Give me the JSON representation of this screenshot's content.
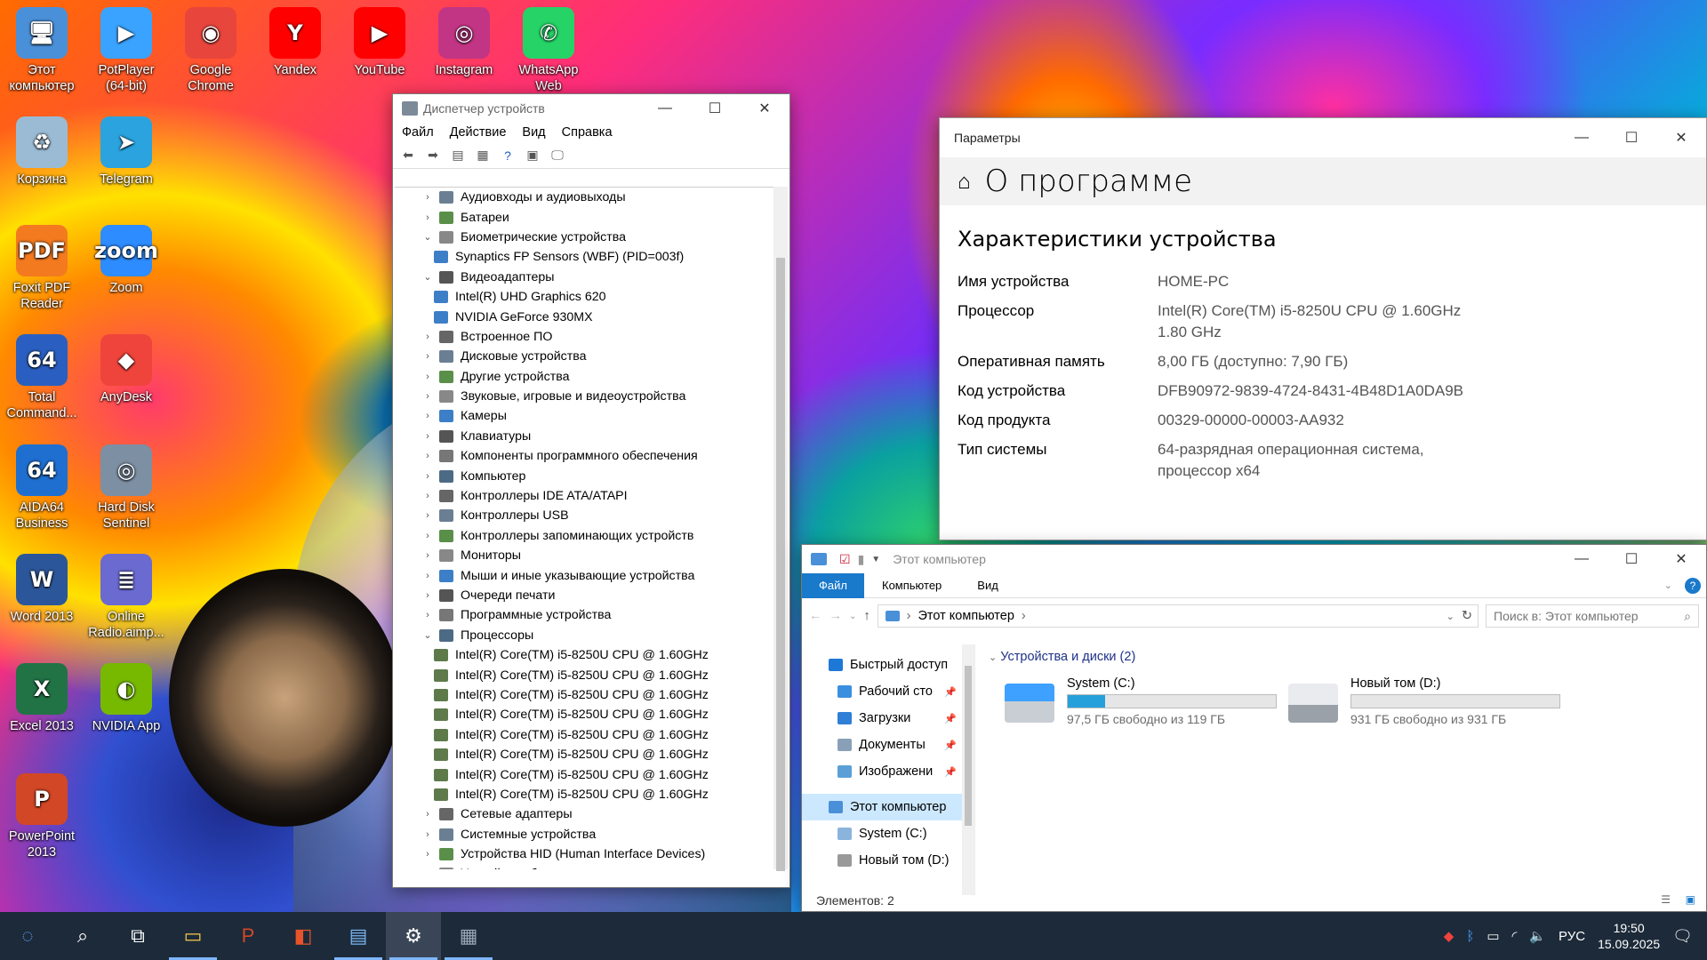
{
  "desktop": {
    "icons": [
      {
        "label": "Этот компьютер",
        "glyph": "🖥",
        "bg": "#4a90d9"
      },
      {
        "label": "PotPlayer (64-bit)",
        "glyph": "▶",
        "bg": "#3aa3ff"
      },
      {
        "label": "Google Chrome",
        "glyph": "◉",
        "bg": "#e8453c"
      },
      {
        "label": "Yandex",
        "glyph": "Y",
        "bg": "#ff0000"
      },
      {
        "label": "YouTube",
        "glyph": "▶",
        "bg": "#ff0000"
      },
      {
        "label": "Instagram",
        "glyph": "◎",
        "bg": "#c13584"
      },
      {
        "label": "WhatsApp Web",
        "glyph": "✆",
        "bg": "#25d366"
      },
      {
        "label": "Корзина",
        "glyph": "♻",
        "bg": "#9bbbd4"
      },
      {
        "label": "Telegram",
        "glyph": "➤",
        "bg": "#2aa3df"
      },
      {
        "label": "Foxit PDF Reader",
        "glyph": "PDF",
        "bg": "#f47a20"
      },
      {
        "label": "Zoom",
        "glyph": "zoom",
        "bg": "#2d8cff"
      },
      {
        "label": "Total Command...",
        "glyph": "64",
        "bg": "#2a5fc1"
      },
      {
        "label": "AnyDesk",
        "glyph": "◆",
        "bg": "#ef443b"
      },
      {
        "label": "AIDA64 Business",
        "glyph": "64",
        "bg": "#1f6fd1"
      },
      {
        "label": "Hard Disk Sentinel",
        "glyph": "◎",
        "bg": "#7d8fa3"
      },
      {
        "label": "Word 2013",
        "glyph": "W",
        "bg": "#2b579a"
      },
      {
        "label": "Online Radio.aimp...",
        "glyph": "≣",
        "bg": "#6a6ad1"
      },
      {
        "label": "Excel 2013",
        "glyph": "X",
        "bg": "#217346"
      },
      {
        "label": "NVIDIA App",
        "glyph": "◐",
        "bg": "#76b900"
      },
      {
        "label": "PowerPoint 2013",
        "glyph": "P",
        "bg": "#d24726"
      }
    ]
  },
  "device_manager": {
    "title": "Диспетчер устройств",
    "menu": [
      "Файл",
      "Действие",
      "Вид",
      "Справка"
    ],
    "tree": [
      {
        "label": "Аудиовходы и аудиовыходы",
        "expanded": false
      },
      {
        "label": "Батареи",
        "expanded": false
      },
      {
        "label": "Биометрические устройства",
        "expanded": true
      },
      {
        "label": "Synaptics FP Sensors (WBF) (PID=003f)",
        "child": true
      },
      {
        "label": "Видеоадаптеры",
        "expanded": true
      },
      {
        "label": "Intel(R) UHD Graphics 620",
        "child": true
      },
      {
        "label": "NVIDIA GeForce 930MX",
        "child": true
      },
      {
        "label": "Встроенное ПО",
        "expanded": false
      },
      {
        "label": "Дисковые устройства",
        "expanded": false
      },
      {
        "label": "Другие устройства",
        "expanded": false
      },
      {
        "label": "Звуковые, игровые и видеоустройства",
        "expanded": false
      },
      {
        "label": "Камеры",
        "expanded": false
      },
      {
        "label": "Клавиатуры",
        "expanded": false
      },
      {
        "label": "Компоненты программного обеспечения",
        "expanded": false
      },
      {
        "label": "Компьютер",
        "expanded": false
      },
      {
        "label": "Контроллеры IDE ATA/ATAPI",
        "expanded": false
      },
      {
        "label": "Контроллеры USB",
        "expanded": false
      },
      {
        "label": "Контроллеры запоминающих устройств",
        "expanded": false
      },
      {
        "label": "Мониторы",
        "expanded": false
      },
      {
        "label": "Мыши и иные указывающие устройства",
        "expanded": false
      },
      {
        "label": "Очереди печати",
        "expanded": false
      },
      {
        "label": "Программные устройства",
        "expanded": false
      },
      {
        "label": "Процессоры",
        "expanded": true
      },
      {
        "label": "Intel(R) Core(TM) i5-8250U CPU @ 1.60GHz",
        "child": true
      },
      {
        "label": "Intel(R) Core(TM) i5-8250U CPU @ 1.60GHz",
        "child": true
      },
      {
        "label": "Intel(R) Core(TM) i5-8250U CPU @ 1.60GHz",
        "child": true
      },
      {
        "label": "Intel(R) Core(TM) i5-8250U CPU @ 1.60GHz",
        "child": true
      },
      {
        "label": "Intel(R) Core(TM) i5-8250U CPU @ 1.60GHz",
        "child": true
      },
      {
        "label": "Intel(R) Core(TM) i5-8250U CPU @ 1.60GHz",
        "child": true
      },
      {
        "label": "Intel(R) Core(TM) i5-8250U CPU @ 1.60GHz",
        "child": true
      },
      {
        "label": "Intel(R) Core(TM) i5-8250U CPU @ 1.60GHz",
        "child": true
      },
      {
        "label": "Сетевые адаптеры",
        "expanded": false
      },
      {
        "label": "Системные устройства",
        "expanded": false
      },
      {
        "label": "Устройства HID (Human Interface Devices)",
        "expanded": false
      },
      {
        "label": "Устройства безопасности",
        "expanded": false
      }
    ]
  },
  "settings": {
    "window_title": "Параметры",
    "page_title": "О программе",
    "section_title": "Характеристики устройства",
    "props": [
      {
        "key": "Имя устройства",
        "value": "HOME-PC"
      },
      {
        "key": "Процессор",
        "value": "Intel(R) Core(TM) i5-8250U CPU @ 1.60GHz 1.80 GHz"
      },
      {
        "key": "Оперативная память",
        "value": "8,00 ГБ (доступно: 7,90 ГБ)"
      },
      {
        "key": "Код устройства",
        "value": "DFB90972-9839-4724-8431-4B48D1A0DA9B"
      },
      {
        "key": "Код продукта",
        "value": "00329-00000-00003-AA932"
      },
      {
        "key": "Тип системы",
        "value": "64-разрядная операционная система, процессор x64"
      }
    ]
  },
  "explorer": {
    "title": "Этот компьютер",
    "ribbon": {
      "file": "Файл",
      "tabs": [
        "Компьютер",
        "Вид"
      ]
    },
    "address": "Этот компьютер",
    "search_placeholder": "Поиск в: Этот компьютер",
    "nav": [
      {
        "label": "Быстрый доступ",
        "level": 0,
        "icon_color": "#1e78d7"
      },
      {
        "label": "Рабочий сто",
        "level": 1,
        "icon_color": "#3b8fe0"
      },
      {
        "label": "Загрузки",
        "level": 1,
        "icon_color": "#2f7fd6"
      },
      {
        "label": "Документы",
        "level": 1,
        "icon_color": "#8aa0b8"
      },
      {
        "label": "Изображени",
        "level": 1,
        "icon_color": "#5aa0d6"
      },
      {
        "label": "Этот компьютер",
        "level": 0,
        "icon_color": "#4a90d9",
        "selected": true
      },
      {
        "label": "System (C:)",
        "level": 1,
        "icon_color": "#8ab4dc"
      },
      {
        "label": "Новый том (D:)",
        "level": 1,
        "icon_color": "#999999"
      }
    ],
    "group_title": "Устройства и диски (2)",
    "drives": [
      {
        "name": "System (C:)",
        "free": "97,5 ГБ свободно из 119 ГБ",
        "used_fraction": 0.18
      },
      {
        "name": "Новый том (D:)",
        "free": "931 ГБ свободно из 931 ГБ",
        "used_fraction": 0.0
      }
    ],
    "status": "Элементов: 2"
  },
  "taskbar": {
    "items": [
      "start",
      "search",
      "task-view",
      "explorer",
      "powerpoint",
      "office",
      "control-panel",
      "settings",
      "app"
    ],
    "lang": "РУС",
    "time": "19:50",
    "date": "15.09.2025",
    "notifications": "1"
  }
}
